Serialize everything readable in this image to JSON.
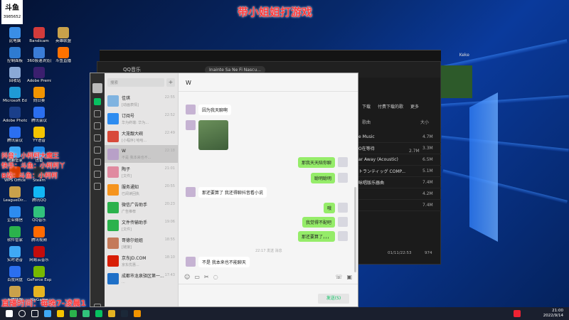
{
  "overlay": {
    "top_title": "带小姐姐打游戏",
    "left_line1": "抖音：小柯柯大魔王",
    "left_line2": "快手：斗鱼：小柯柯丫",
    "left_line3": "B站：斗鱼：小柯柯",
    "bottom_line": "直播时间：每晚7-凌晨1",
    "id_label": "斗鱼",
    "id_number": "3985652"
  },
  "desktop_icons": [
    {
      "label": "此电脑",
      "color": "#3a8ee6"
    },
    {
      "label": "控制面板",
      "color": "#2e7bd1"
    },
    {
      "label": "回收站",
      "color": "#8aa9d6"
    },
    {
      "label": "Microsoft Edge",
      "color": "#1f9ad6"
    },
    {
      "label": "Adobe Photosh...",
      "color": "#1a3f8a"
    },
    {
      "label": "腾讯会议",
      "color": "#2b6ff0"
    },
    {
      "label": "电脑管家",
      "color": "#3fa9f5"
    },
    {
      "label": "WPS Office",
      "color": "#d83b01"
    },
    {
      "label": "LeagueDir...",
      "color": "#c9a14b"
    },
    {
      "label": "企业微信",
      "color": "#2d8cf0"
    },
    {
      "label": "软件管家",
      "color": "#2bb24c"
    },
    {
      "label": "实时语音",
      "color": "#3fa9f5"
    },
    {
      "label": "百度网盘",
      "color": "#2b6ff0"
    },
    {
      "label": "英雄联盟",
      "color": "#c9a14b"
    },
    {
      "label": "Bandicam",
      "color": "#d33b3b"
    },
    {
      "label": "360极速浏览器",
      "color": "#3b7dd8"
    },
    {
      "label": "Adobe Premie...",
      "color": "#3b1f6e"
    },
    {
      "label": "向日葵",
      "color": "#f29400"
    },
    {
      "label": "腾讯会议",
      "color": "#2b6ff0"
    },
    {
      "label": "YY语音",
      "color": "#f5c400"
    },
    {
      "label": "迅雷",
      "color": "#1e88e5"
    },
    {
      "label": "Steam",
      "color": "#1b2838"
    },
    {
      "label": "腾讯QQ",
      "color": "#12b7f5"
    },
    {
      "label": "QQ音乐",
      "color": "#31c27c"
    },
    {
      "label": "腾讯视频",
      "color": "#ff6a00"
    },
    {
      "label": "网易云音乐",
      "color": "#c20c0c"
    },
    {
      "label": "GeForce Experience",
      "color": "#76b900"
    },
    {
      "label": "WeGame",
      "color": "#e6b422"
    },
    {
      "label": "英雄联盟",
      "color": "#c9a14b"
    },
    {
      "label": "斗鱼直播",
      "color": "#ff7200"
    }
  ],
  "music": {
    "tab_title": "QQ音乐",
    "now_playing": "Inainte Sa Ne Fi Nascu...",
    "user": "Keke",
    "menu": [
      "下载",
      "付费下载的歌",
      "更多"
    ],
    "header_cols": [
      "歌曲",
      "大小"
    ],
    "rows": [
      {
        "title": "e Music",
        "size": "4.7M"
      },
      {
        "title": "O在等待",
        "size": "3.3M"
      },
      {
        "title": "ar Away (Acoustic)",
        "size": "6.5M"
      },
      {
        "title": "トランティッグ COMP...",
        "size": "5.1M"
      },
      {
        "title": "咏唱版乐器曲",
        "size": "7.4M"
      }
    ],
    "first_size": "2.7M",
    "sizes_extra": [
      "4.2M",
      "7.4M"
    ],
    "footer_time": "01/11/22:53",
    "footer_count": "974"
  },
  "wechat": {
    "search_placeholder": "搜索",
    "plus": "+",
    "chat_title": "W",
    "contacts": [
      {
        "name": "佳琪",
        "preview": "[动画表情]",
        "time": "22:55",
        "color": "#7fb3e0"
      },
      {
        "name": "订阅号",
        "preview": "华为终端: 华为...",
        "time": "22:52",
        "color": "#2d8cf0"
      },
      {
        "name": "大笼靓大碗",
        "preview": "[小程序] 哈哈...",
        "time": "22:49",
        "color": "#d84a3a"
      },
      {
        "name": "W",
        "preview": "不是 我本来也不...",
        "time": "22:18",
        "color": "#b8a0c8"
      },
      {
        "name": "陶子",
        "preview": "[文件]",
        "time": "21:01",
        "color": "#e08aa0"
      },
      {
        "name": "服务通知",
        "preview": "已阅读回执",
        "time": "20:55",
        "color": "#f5941e"
      },
      {
        "name": "微信广告助手",
        "preview": "广告推荐",
        "time": "20:23",
        "color": "#2bb24c"
      },
      {
        "name": "文件传输助手",
        "preview": "[文件]",
        "time": "19:06",
        "color": "#2bb24c"
      },
      {
        "name": "哥德尔姐姐",
        "preview": "[链接]",
        "time": "18:55",
        "color": "#c47a5a"
      },
      {
        "name": "京东JD.COM",
        "preview": "京东优惠...",
        "time": "18:10",
        "color": "#d81e06"
      },
      {
        "name": "成都市龙泉驿区第一...",
        "preview": "...",
        "time": "17:43",
        "color": "#1e6fc7"
      }
    ],
    "messages": [
      {
        "side": "left",
        "text": "因为我天聊啊"
      },
      {
        "side": "left",
        "text": "[image]"
      },
      {
        "side": "right",
        "text": "那我天天陪你聊"
      },
      {
        "side": "right",
        "text": "聪明聪明"
      },
      {
        "side": "left",
        "text": "那还要算了 我还得聊抖音看小说"
      },
      {
        "side": "right",
        "text": "哦"
      },
      {
        "side": "right",
        "text": "我觉得不配吧"
      },
      {
        "side": "right",
        "text": "那还要算了，，，"
      },
      {
        "side": "left",
        "text": "不是 我本来也不能聊天"
      }
    ],
    "system_time": "22:17 发送 消息",
    "send_label": "发送(S)"
  },
  "taskbar": {
    "time": "21:00",
    "date": "2022/9/14"
  }
}
